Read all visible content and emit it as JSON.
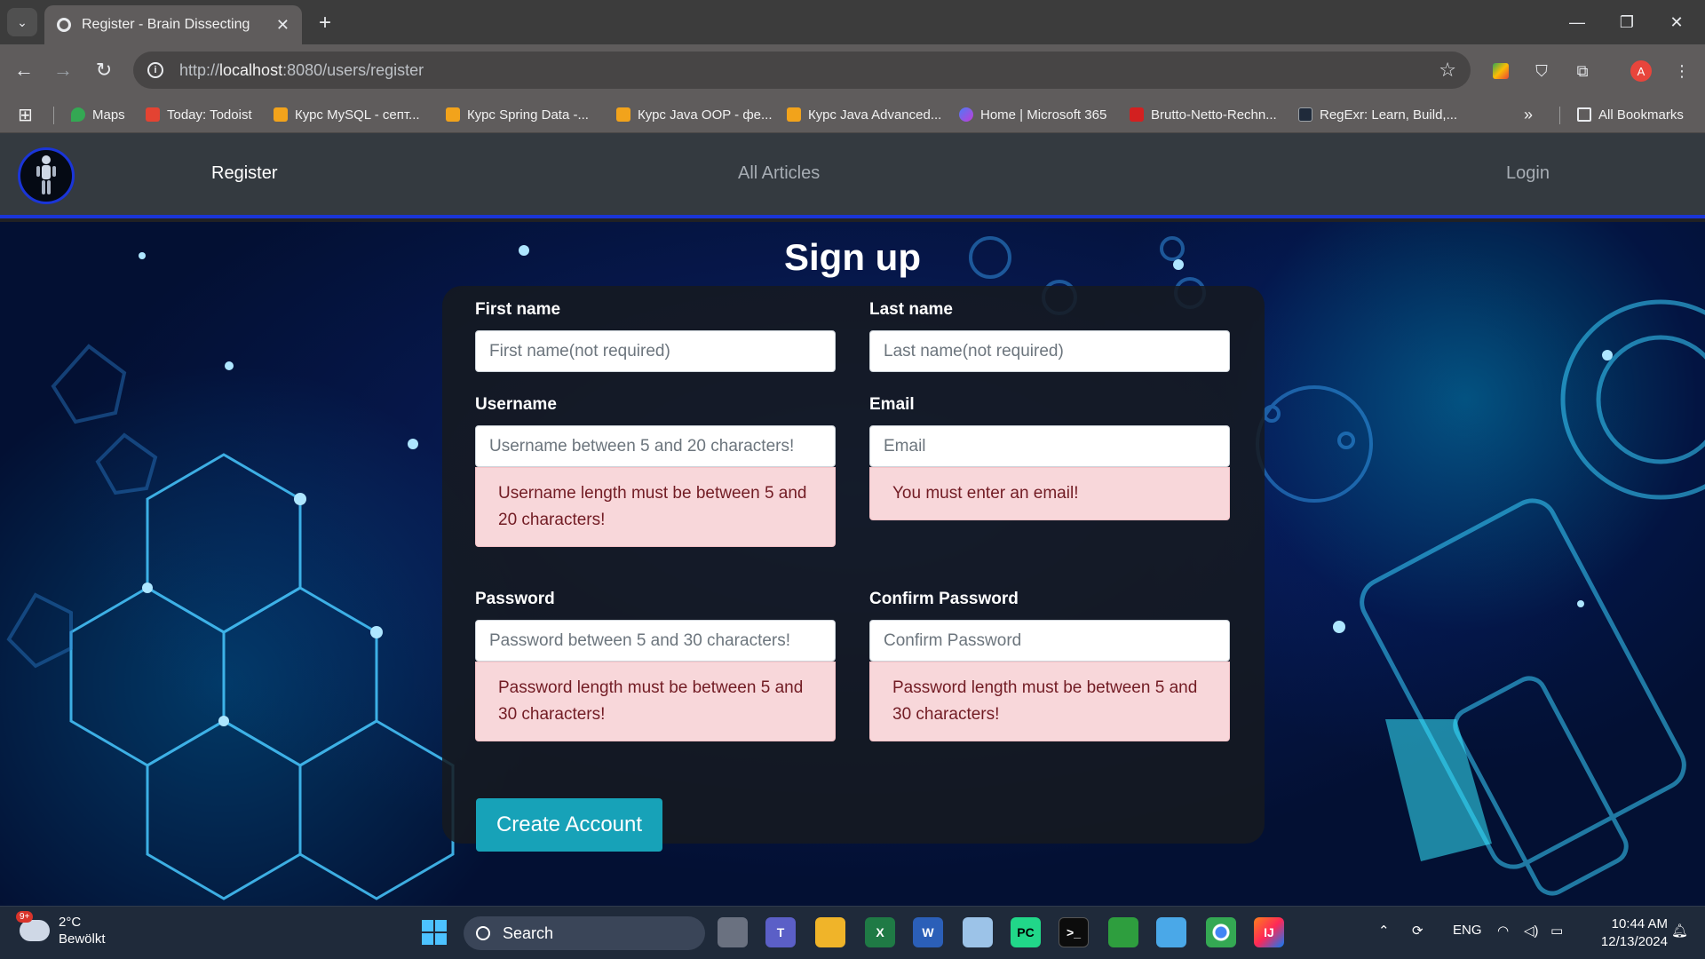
{
  "browser": {
    "tab_title": "Register - Brain Dissecting",
    "url_prefix": "http://",
    "url_host": "localhost",
    "url_rest": ":8080/users/register",
    "bookmarks": [
      "Maps",
      "Today: Todoist",
      "Курс MySQL - септ...",
      "Курс Spring Data -...",
      "Курс Java OOP - фе...",
      "Курс Java Advanced...",
      "Home | Microsoft 365",
      "Brutto-Netto-Rechn...",
      "RegExr: Learn, Build,..."
    ],
    "all_bookmarks": "All Bookmarks",
    "profile_initial": "A",
    "colors": {
      "chrome": "#3c3c3c",
      "toolbar": "#5f5c5c",
      "omnibox": "#474545"
    }
  },
  "site": {
    "nav": {
      "register": "Register",
      "all_articles": "All Articles",
      "login": "Login"
    },
    "title": "Sign up",
    "form": {
      "first_name": {
        "label": "First name",
        "placeholder": "First name(not required)",
        "value": ""
      },
      "last_name": {
        "label": "Last name",
        "placeholder": "Last name(not required)",
        "value": ""
      },
      "username": {
        "label": "Username",
        "placeholder": "Username between 5 and 20 characters!",
        "value": "",
        "error": "Username length must be between 5 and 20 characters!"
      },
      "email": {
        "label": "Email",
        "placeholder": "Email",
        "value": "",
        "error": "You must enter an email!"
      },
      "password": {
        "label": "Password",
        "placeholder": "Password between 5 and 30 characters!",
        "value": "",
        "error": "Password length must be between 5 and 30 characters!"
      },
      "confirm_password": {
        "label": "Confirm Password",
        "placeholder": "Confirm Password",
        "value": "",
        "error": "Password length must be between 5 and 30 characters!"
      },
      "submit": "Create Account"
    },
    "colors": {
      "navbar": "#343a40",
      "accent_border": "#1a35d8",
      "button": "#17a2b8",
      "error_bg": "#f8d7da",
      "error_text": "#721c24"
    }
  },
  "taskbar": {
    "weather_badge": "9+",
    "temperature": "2°C",
    "condition": "Bewölkt",
    "search": "Search",
    "language": "ENG",
    "time": "10:44 AM",
    "date": "12/13/2024"
  }
}
